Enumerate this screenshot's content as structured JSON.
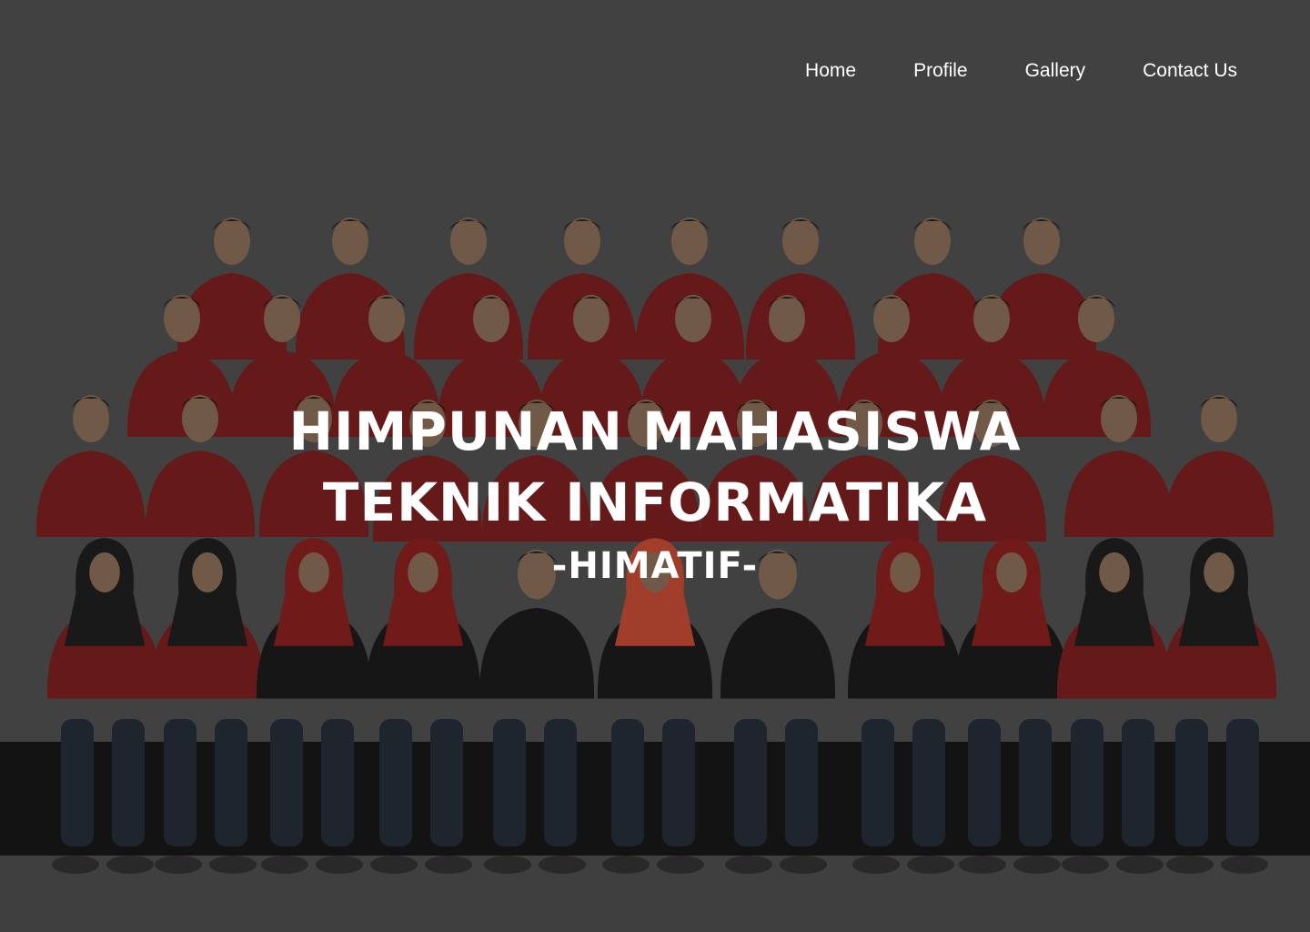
{
  "nav": {
    "items": [
      {
        "label": "Home"
      },
      {
        "label": "Profile"
      },
      {
        "label": "Gallery"
      },
      {
        "label": "Contact Us"
      }
    ]
  },
  "hero": {
    "title_line1": "HIMPUNAN MAHASISWA",
    "title_line2": "TEKNIK INFORMATIKA",
    "subtitle": "-HIMATIF-"
  },
  "colors": {
    "background": "#4a4a4a",
    "shirt_red": "#7a1414",
    "shirt_black": "#111111",
    "hijab_black": "#141414",
    "hijab_red": "#8a1616",
    "hijab_orange": "#c9442c",
    "text": "#ffffff"
  }
}
